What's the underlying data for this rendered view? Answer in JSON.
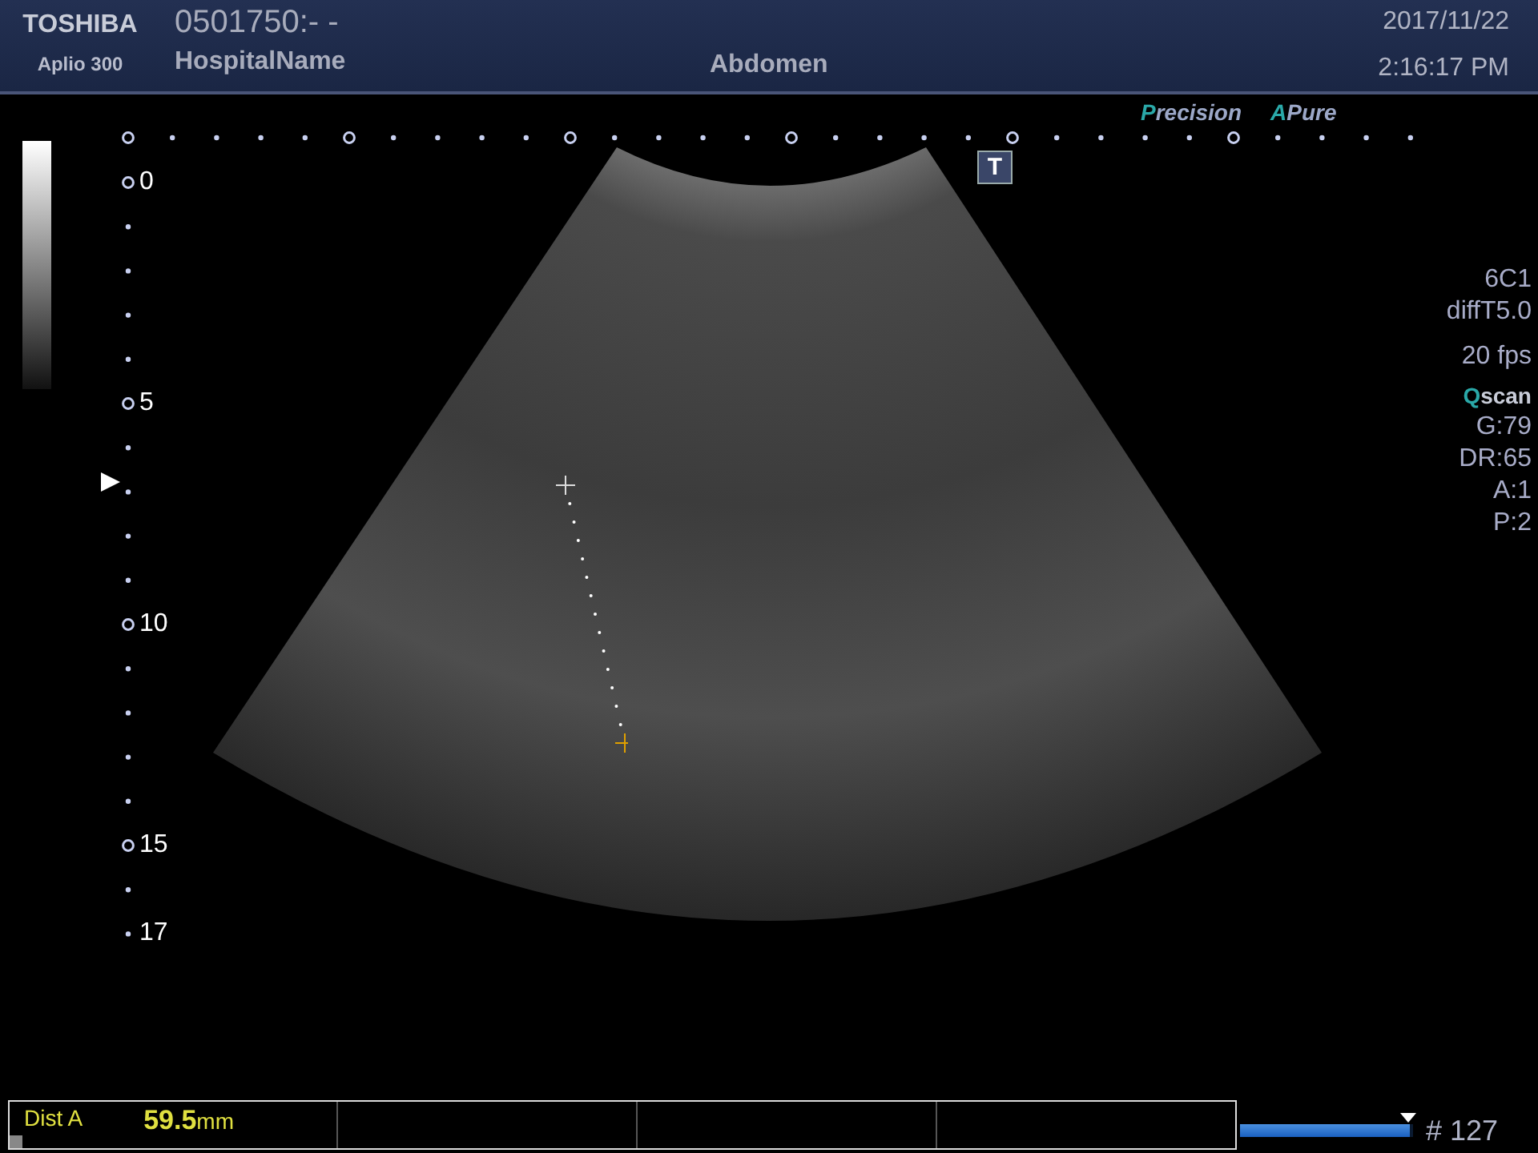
{
  "header": {
    "brand": "TOSHIBA",
    "model": "Aplio 300",
    "patient_id": "0501750:- -",
    "hospital": "HospitalName",
    "exam": "Abdomen",
    "date": "2017/11/22",
    "time": "2:16:17 PM"
  },
  "logos": [
    {
      "initial": "P",
      "rest": "recision"
    },
    {
      "initial": "A",
      "rest": "Pure"
    }
  ],
  "image_mode_badge": "T",
  "depth_labels": [
    "0",
    "5",
    "10",
    "15",
    "17"
  ],
  "parameters": [
    {
      "kind": "plain",
      "text": "6C1"
    },
    {
      "kind": "plain",
      "text": "diffT5.0"
    },
    {
      "kind": "gap",
      "text": "20 fps"
    },
    {
      "kind": "logo",
      "initial": "Q",
      "text": "scan"
    },
    {
      "kind": "plain",
      "text": "G:79"
    },
    {
      "kind": "plain",
      "text": "DR:65"
    },
    {
      "kind": "plain",
      "text": "A:1"
    },
    {
      "kind": "plain",
      "text": "P:2"
    }
  ],
  "measurement": {
    "label": "Dist A",
    "value": "59.5",
    "unit": "mm"
  },
  "cine": {
    "level": 0.98,
    "frame": "# 127"
  }
}
